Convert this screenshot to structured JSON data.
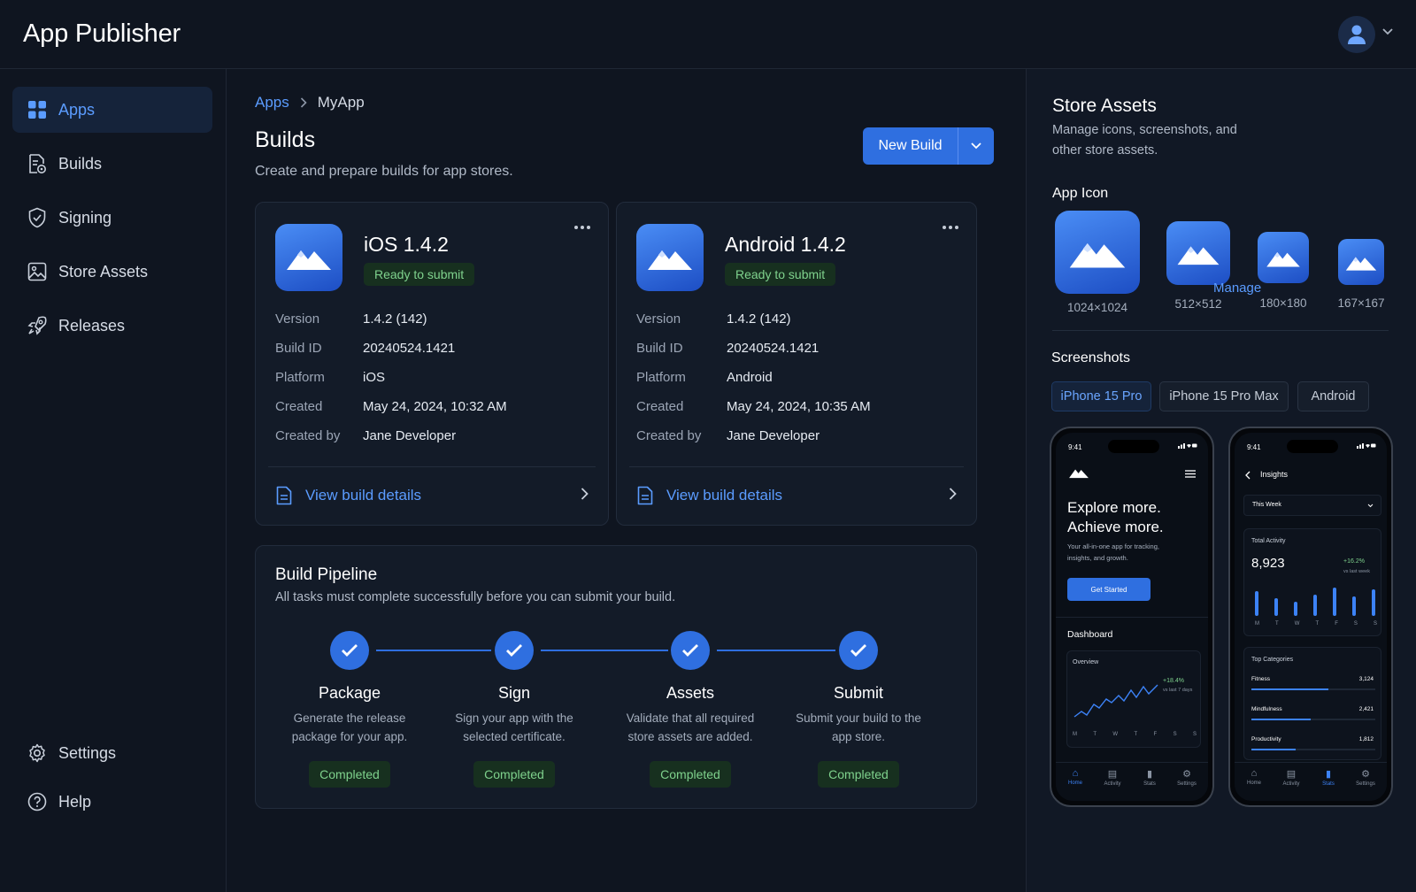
{
  "app": {
    "title": "App Publisher"
  },
  "header": {
    "avatar_icon": "user-icon",
    "caret_icon": "chevron-down-icon"
  },
  "sidebar": {
    "items": [
      {
        "label": "Apps",
        "icon": "grid-icon",
        "active": true
      },
      {
        "label": "Builds",
        "icon": "build-doc-icon"
      },
      {
        "label": "Signing",
        "icon": "shield-check-icon"
      },
      {
        "label": "Store Assets",
        "icon": "image-icon"
      },
      {
        "label": "Releases",
        "icon": "rocket-icon"
      }
    ],
    "bottom": [
      {
        "label": "Settings",
        "icon": "gear-icon"
      },
      {
        "label": "Help",
        "icon": "help-circle-icon"
      }
    ]
  },
  "breadcrumb": {
    "root": "Apps",
    "current": "MyApp"
  },
  "page": {
    "title": "Builds",
    "subtitle": "Create and prepare builds for app stores.",
    "new_build": "New Build"
  },
  "builds": [
    {
      "title": "iOS 1.4.2",
      "status": "Ready to submit",
      "fields": [
        {
          "k": "Version",
          "v": "1.4.2 (142)"
        },
        {
          "k": "Build ID",
          "v": "20240524.1421"
        },
        {
          "k": "Platform",
          "v": "iOS"
        },
        {
          "k": "Created",
          "v": "May 24, 2024, 10:32 AM"
        },
        {
          "k": "Created by",
          "v": "Jane Developer"
        }
      ],
      "link": "View build details"
    },
    {
      "title": "Android 1.4.2",
      "status": "Ready to submit",
      "fields": [
        {
          "k": "Version",
          "v": "1.4.2 (142)"
        },
        {
          "k": "Build ID",
          "v": "20240524.1421"
        },
        {
          "k": "Platform",
          "v": "Android"
        },
        {
          "k": "Created",
          "v": "May 24, 2024, 10:35 AM"
        },
        {
          "k": "Created by",
          "v": "Jane Developer"
        }
      ],
      "link": "View build details"
    }
  ],
  "pipeline": {
    "title": "Build Pipeline",
    "subtitle": "All tasks must complete successfully before you can submit your build.",
    "steps": [
      {
        "name": "Package",
        "desc1": "Generate the release",
        "desc2": "package for your app.",
        "status": "Completed"
      },
      {
        "name": "Sign",
        "desc1": "Sign your app with the",
        "desc2": "selected certificate.",
        "status": "Completed"
      },
      {
        "name": "Assets",
        "desc1": "Validate that all required",
        "desc2": "store assets are added.",
        "status": "Completed"
      },
      {
        "name": "Submit",
        "desc1": "Submit your build to the",
        "desc2": "app store.",
        "status": "Completed"
      }
    ]
  },
  "store_assets": {
    "title": "Store Assets",
    "subtitle": "Manage icons, screenshots, and other store assets.",
    "app_icon_heading": "App Icon",
    "icon_sizes": [
      "1024×1024",
      "512×512",
      "180×180",
      "167×167"
    ],
    "screenshots_heading": "Screenshots",
    "manage": "Manage",
    "device_tabs": [
      "iPhone 15 Pro",
      "iPhone 15 Pro Max",
      "Android"
    ],
    "active_device": "iPhone 15 Pro"
  },
  "phone1": {
    "time": "9:41",
    "headline1": "Explore more.",
    "headline2": "Achieve more.",
    "body1": "Your all-in-one app for tracking,",
    "body2": "insights, and growth.",
    "cta": "Get Started",
    "dashboard": "Dashboard",
    "overview": "Overview",
    "delta": "+18.4%",
    "delta_note": "vs last 7 days",
    "days": [
      "M",
      "T",
      "W",
      "T",
      "F",
      "S",
      "S"
    ],
    "tabs": [
      "Home",
      "Activity",
      "Stats",
      "Settings"
    ],
    "active_tab": "Home"
  },
  "phone2": {
    "time": "9:41",
    "title": "Insights",
    "range": "This Week",
    "total_label": "Total Activity",
    "total_value": "8,923",
    "delta": "+16.2%",
    "delta_note": "vs last week",
    "days": [
      "M",
      "T",
      "W",
      "T",
      "F",
      "S",
      "S"
    ],
    "categories_title": "Top Categories",
    "categories": [
      {
        "name": "Fitness",
        "value": "3,124",
        "share": 0.62
      },
      {
        "name": "Mindfulness",
        "value": "2,421",
        "share": 0.48
      },
      {
        "name": "Productivity",
        "value": "1,812",
        "share": 0.36
      }
    ],
    "tabs": [
      "Home",
      "Activity",
      "Stats",
      "Settings"
    ],
    "active_tab": "Stats"
  },
  "colors": {
    "accent": "#2f6fe0",
    "link": "#5b9cff",
    "success": "#7fd28d",
    "bg": "#0f1520"
  }
}
